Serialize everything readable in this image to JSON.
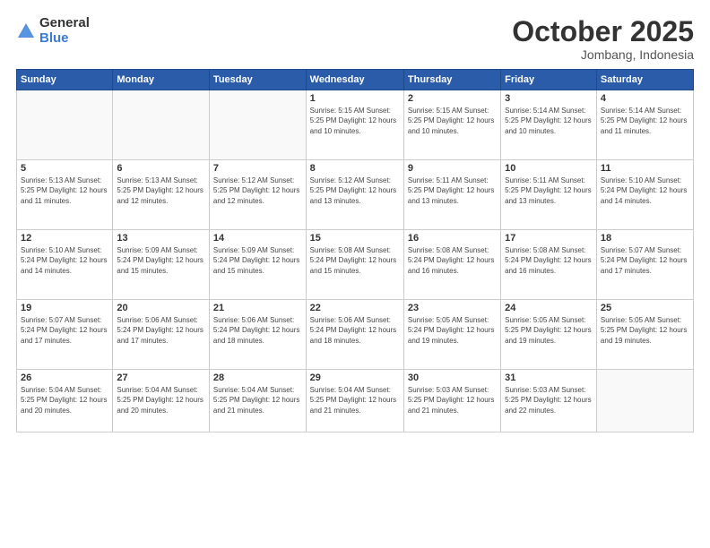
{
  "header": {
    "logo_general": "General",
    "logo_blue": "Blue",
    "month": "October 2025",
    "location": "Jombang, Indonesia"
  },
  "weekdays": [
    "Sunday",
    "Monday",
    "Tuesday",
    "Wednesday",
    "Thursday",
    "Friday",
    "Saturday"
  ],
  "weeks": [
    [
      {
        "day": "",
        "info": ""
      },
      {
        "day": "",
        "info": ""
      },
      {
        "day": "",
        "info": ""
      },
      {
        "day": "1",
        "info": "Sunrise: 5:15 AM\nSunset: 5:25 PM\nDaylight: 12 hours\nand 10 minutes."
      },
      {
        "day": "2",
        "info": "Sunrise: 5:15 AM\nSunset: 5:25 PM\nDaylight: 12 hours\nand 10 minutes."
      },
      {
        "day": "3",
        "info": "Sunrise: 5:14 AM\nSunset: 5:25 PM\nDaylight: 12 hours\nand 10 minutes."
      },
      {
        "day": "4",
        "info": "Sunrise: 5:14 AM\nSunset: 5:25 PM\nDaylight: 12 hours\nand 11 minutes."
      }
    ],
    [
      {
        "day": "5",
        "info": "Sunrise: 5:13 AM\nSunset: 5:25 PM\nDaylight: 12 hours\nand 11 minutes."
      },
      {
        "day": "6",
        "info": "Sunrise: 5:13 AM\nSunset: 5:25 PM\nDaylight: 12 hours\nand 12 minutes."
      },
      {
        "day": "7",
        "info": "Sunrise: 5:12 AM\nSunset: 5:25 PM\nDaylight: 12 hours\nand 12 minutes."
      },
      {
        "day": "8",
        "info": "Sunrise: 5:12 AM\nSunset: 5:25 PM\nDaylight: 12 hours\nand 13 minutes."
      },
      {
        "day": "9",
        "info": "Sunrise: 5:11 AM\nSunset: 5:25 PM\nDaylight: 12 hours\nand 13 minutes."
      },
      {
        "day": "10",
        "info": "Sunrise: 5:11 AM\nSunset: 5:25 PM\nDaylight: 12 hours\nand 13 minutes."
      },
      {
        "day": "11",
        "info": "Sunrise: 5:10 AM\nSunset: 5:24 PM\nDaylight: 12 hours\nand 14 minutes."
      }
    ],
    [
      {
        "day": "12",
        "info": "Sunrise: 5:10 AM\nSunset: 5:24 PM\nDaylight: 12 hours\nand 14 minutes."
      },
      {
        "day": "13",
        "info": "Sunrise: 5:09 AM\nSunset: 5:24 PM\nDaylight: 12 hours\nand 15 minutes."
      },
      {
        "day": "14",
        "info": "Sunrise: 5:09 AM\nSunset: 5:24 PM\nDaylight: 12 hours\nand 15 minutes."
      },
      {
        "day": "15",
        "info": "Sunrise: 5:08 AM\nSunset: 5:24 PM\nDaylight: 12 hours\nand 15 minutes."
      },
      {
        "day": "16",
        "info": "Sunrise: 5:08 AM\nSunset: 5:24 PM\nDaylight: 12 hours\nand 16 minutes."
      },
      {
        "day": "17",
        "info": "Sunrise: 5:08 AM\nSunset: 5:24 PM\nDaylight: 12 hours\nand 16 minutes."
      },
      {
        "day": "18",
        "info": "Sunrise: 5:07 AM\nSunset: 5:24 PM\nDaylight: 12 hours\nand 17 minutes."
      }
    ],
    [
      {
        "day": "19",
        "info": "Sunrise: 5:07 AM\nSunset: 5:24 PM\nDaylight: 12 hours\nand 17 minutes."
      },
      {
        "day": "20",
        "info": "Sunrise: 5:06 AM\nSunset: 5:24 PM\nDaylight: 12 hours\nand 17 minutes."
      },
      {
        "day": "21",
        "info": "Sunrise: 5:06 AM\nSunset: 5:24 PM\nDaylight: 12 hours\nand 18 minutes."
      },
      {
        "day": "22",
        "info": "Sunrise: 5:06 AM\nSunset: 5:24 PM\nDaylight: 12 hours\nand 18 minutes."
      },
      {
        "day": "23",
        "info": "Sunrise: 5:05 AM\nSunset: 5:24 PM\nDaylight: 12 hours\nand 19 minutes."
      },
      {
        "day": "24",
        "info": "Sunrise: 5:05 AM\nSunset: 5:25 PM\nDaylight: 12 hours\nand 19 minutes."
      },
      {
        "day": "25",
        "info": "Sunrise: 5:05 AM\nSunset: 5:25 PM\nDaylight: 12 hours\nand 19 minutes."
      }
    ],
    [
      {
        "day": "26",
        "info": "Sunrise: 5:04 AM\nSunset: 5:25 PM\nDaylight: 12 hours\nand 20 minutes."
      },
      {
        "day": "27",
        "info": "Sunrise: 5:04 AM\nSunset: 5:25 PM\nDaylight: 12 hours\nand 20 minutes."
      },
      {
        "day": "28",
        "info": "Sunrise: 5:04 AM\nSunset: 5:25 PM\nDaylight: 12 hours\nand 21 minutes."
      },
      {
        "day": "29",
        "info": "Sunrise: 5:04 AM\nSunset: 5:25 PM\nDaylight: 12 hours\nand 21 minutes."
      },
      {
        "day": "30",
        "info": "Sunrise: 5:03 AM\nSunset: 5:25 PM\nDaylight: 12 hours\nand 21 minutes."
      },
      {
        "day": "31",
        "info": "Sunrise: 5:03 AM\nSunset: 5:25 PM\nDaylight: 12 hours\nand 22 minutes."
      },
      {
        "day": "",
        "info": ""
      }
    ]
  ]
}
